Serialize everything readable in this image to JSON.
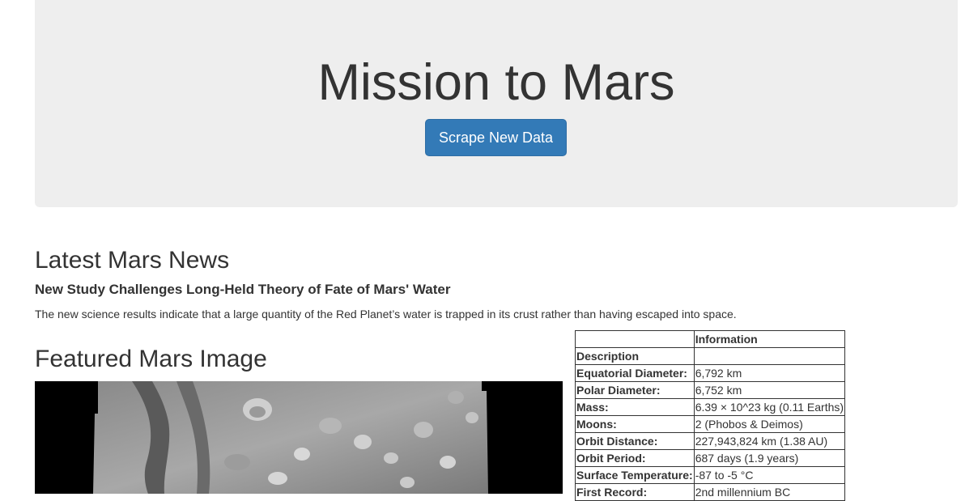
{
  "header": {
    "title": "Mission to Mars",
    "button_label": "Scrape New Data"
  },
  "news": {
    "heading": "Latest Mars News",
    "title": "New Study Challenges Long-Held Theory of Fate of Mars' Water",
    "body": "The new science results indicate that a large quantity of the Red Planet’s water is trapped in its crust rather than having escaped into space."
  },
  "featured": {
    "heading": "Featured Mars Image",
    "image_name": "mars-surface-grayscale-image"
  },
  "facts": {
    "header_col1": "",
    "header_col2": "Information",
    "rows": [
      {
        "label": "Description",
        "value": ""
      },
      {
        "label": "Equatorial Diameter:",
        "value": "6,792 km"
      },
      {
        "label": "Polar Diameter:",
        "value": "6,752 km"
      },
      {
        "label": "Mass:",
        "value": "6.39 × 10^23 kg (0.11 Earths)"
      },
      {
        "label": "Moons:",
        "value": "2 (Phobos & Deimos)"
      },
      {
        "label": "Orbit Distance:",
        "value": "227,943,824 km (1.38 AU)"
      },
      {
        "label": "Orbit Period:",
        "value": "687 days (1.9 years)"
      },
      {
        "label": "Surface Temperature:",
        "value": "-87 to -5 °C"
      },
      {
        "label": "First Record:",
        "value": "2nd millennium BC"
      }
    ]
  },
  "colors": {
    "jumbotron_bg": "#eeeeee",
    "button_bg": "#337ab7",
    "text": "#333333"
  }
}
